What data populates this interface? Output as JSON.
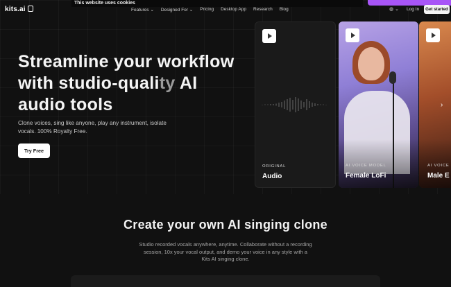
{
  "nav": {
    "logo": "kits.ai",
    "cookie_banner": "This website uses cookies",
    "links": [
      "Features",
      "Designed For",
      "Pricing",
      "Desktop App",
      "Research",
      "Blog"
    ],
    "language_icon": "globe-icon",
    "login": "Log In",
    "get_started": "Get started"
  },
  "hero": {
    "title_main": "Streamline your workflow with studio-quali",
    "title_dim": "ty",
    "title_end": " AI audio tools",
    "subtitle": "Clone voices, sing like anyone, play any instrument, isolate vocals. 100% Royalty Free.",
    "cta": "Try Free"
  },
  "cards": [
    {
      "kicker": "ORIGINAL",
      "name": "Audio"
    },
    {
      "kicker": "AI VOICE MODEL",
      "name": "Female LoFi"
    },
    {
      "kicker": "AI VOICE",
      "name": "Male E"
    }
  ],
  "section": {
    "title": "Create your own AI singing clone",
    "text": "Studio recorded vocals anywhere, anytime. Collaborate without a recording session, 10x your vocal output, and demo your voice in any style with a Kits AI singing clone."
  },
  "colors": {
    "background": "#111111",
    "accent": "#a855f7"
  }
}
